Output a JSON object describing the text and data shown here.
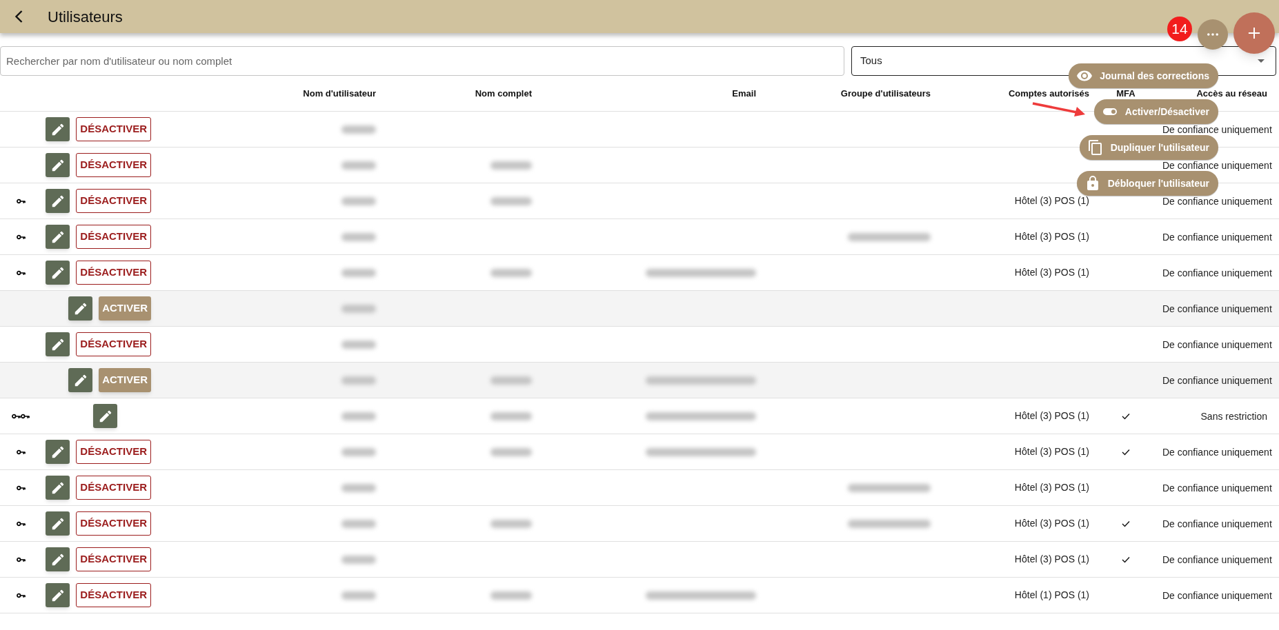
{
  "header": {
    "title": "Utilisateurs"
  },
  "badge": "14",
  "search": {
    "placeholder": "Rechercher par nom d'utilisateur ou nom complet"
  },
  "filter": {
    "value": "Tous"
  },
  "columns": [
    "Nom d'utilisateur",
    "Nom complet",
    "Email",
    "Groupe d'utilisateurs",
    "Comptes autorisés",
    "MFA",
    "Accès au réseau"
  ],
  "rows": [
    {
      "kind": "active",
      "toggle_label": "DÉSACTIVER",
      "username_hidden": true,
      "full_name_hidden": false,
      "email_hidden": false,
      "group_hidden": false,
      "mfa": false,
      "access": "De confiance uniquement"
    },
    {
      "kind": "active",
      "toggle_label": "DÉSACTIVER",
      "username_hidden": true,
      "full_name_hidden": true,
      "email_hidden": false,
      "group_hidden": false,
      "mfa": false,
      "access": "De confiance uniquement"
    },
    {
      "kind": "active",
      "keys": [
        {
          "kind": "key"
        }
      ],
      "toggle_label": "DÉSACTIVER",
      "username_hidden": true,
      "full_name_hidden": true,
      "email_hidden": false,
      "group_hidden": false,
      "accounts": "Hôtel (3) POS (1)",
      "mfa": false,
      "access": "De confiance uniquement"
    },
    {
      "kind": "active",
      "keys": [
        {
          "kind": "key"
        }
      ],
      "toggle_label": "DÉSACTIVER",
      "username_hidden": true,
      "full_name_hidden": false,
      "email_hidden": false,
      "group_hidden": true,
      "accounts": "Hôtel (3) POS (1)",
      "mfa": false,
      "access": "De confiance uniquement"
    },
    {
      "kind": "active",
      "keys": [
        {
          "kind": "key"
        }
      ],
      "toggle_label": "DÉSACTIVER",
      "username_hidden": true,
      "full_name_hidden": true,
      "email_hidden": true,
      "group_hidden": false,
      "accounts": "Hôtel (3) POS (1)",
      "mfa": false,
      "access": "De confiance uniquement"
    },
    {
      "kind": "inactive",
      "toggle_label": "ACTIVER",
      "username_hidden": true,
      "full_name_hidden": false,
      "email_hidden": false,
      "group_hidden": false,
      "mfa": false,
      "access": "De confiance uniquement"
    },
    {
      "kind": "active",
      "toggle_label": "DÉSACTIVER",
      "username_hidden": true,
      "full_name_hidden": false,
      "email_hidden": false,
      "group_hidden": false,
      "mfa": false,
      "access": "De confiance uniquement"
    },
    {
      "kind": "inactive",
      "toggle_label": "ACTIVER",
      "username_hidden": true,
      "full_name_hidden": true,
      "email_hidden": true,
      "group_hidden": false,
      "mfa": false,
      "access": "De confiance uniquement"
    },
    {
      "kind": "edit_only",
      "keys": [
        {
          "kind": "key"
        },
        {
          "kind": "key"
        }
      ],
      "username_hidden": true,
      "full_name_hidden": true,
      "email_hidden": true,
      "group_hidden": false,
      "accounts": "Hôtel (3) POS (1)",
      "mfa": true,
      "access": "Sans restriction"
    },
    {
      "kind": "active",
      "keys": [
        {
          "kind": "key"
        }
      ],
      "toggle_label": "DÉSACTIVER",
      "username_hidden": true,
      "full_name_hidden": true,
      "email_hidden": true,
      "group_hidden": false,
      "accounts": "Hôtel (3) POS (1)",
      "mfa": true,
      "access": "De confiance uniquement"
    },
    {
      "kind": "active",
      "keys": [
        {
          "kind": "key"
        }
      ],
      "toggle_label": "DÉSACTIVER",
      "username_hidden": true,
      "full_name_hidden": false,
      "email_hidden": false,
      "group_hidden": true,
      "accounts": "Hôtel (3) POS (1)",
      "mfa": false,
      "access": "De confiance uniquement"
    },
    {
      "kind": "active",
      "keys": [
        {
          "kind": "key"
        }
      ],
      "toggle_label": "DÉSACTIVER",
      "username_hidden": true,
      "full_name_hidden": true,
      "email_hidden": false,
      "group_hidden": true,
      "accounts": "Hôtel (3) POS (1)",
      "mfa": true,
      "access": "De confiance uniquement"
    },
    {
      "kind": "active",
      "keys": [
        {
          "kind": "key"
        }
      ],
      "toggle_label": "DÉSACTIVER",
      "username_hidden": true,
      "full_name_hidden": false,
      "email_hidden": false,
      "group_hidden": false,
      "accounts": "Hôtel (3) POS (1)",
      "mfa": true,
      "access": "De confiance uniquement"
    },
    {
      "kind": "active",
      "keys": [
        {
          "kind": "key"
        }
      ],
      "toggle_label": "DÉSACTIVER",
      "username_hidden": true,
      "full_name_hidden": true,
      "email_hidden": true,
      "group_hidden": false,
      "accounts": "Hôtel (1) POS (1)",
      "mfa": false,
      "access": "De confiance uniquement"
    }
  ],
  "menu": [
    {
      "kind": "eye",
      "label": "Journal des corrections"
    },
    {
      "kind": "toggle",
      "label": "Activer/Désactiver"
    },
    {
      "kind": "copy",
      "label": "Dupliquer l'utilisateur"
    },
    {
      "kind": "lock",
      "label": "Débloquer l'utilisateur"
    }
  ]
}
